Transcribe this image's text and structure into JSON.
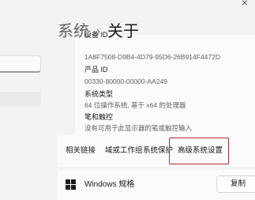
{
  "window": {
    "close_glyph": "×"
  },
  "header": {
    "parent": "系统",
    "separator": "›",
    "title": "关于"
  },
  "device_specs": {
    "device_id_label": "设备 ID",
    "device_id_value": "1A8F7508-D9B4-4D79-95D6-26B914F4472D",
    "product_id_label": "产品 ID",
    "product_id_value": "00330-80000-00000-AA249",
    "system_type_label": "系统类型",
    "system_type_value": "64 位操作系统, 基于 x64 的处理器",
    "pen_touch_label": "笔和触控",
    "pen_touch_value": "没有可用于此显示器的笔或触控输入"
  },
  "related_links": {
    "heading": "相关链接",
    "items": [
      "域或工作组",
      "系统保护",
      "高级系统设置"
    ],
    "highlight_color": "#a73235"
  },
  "windows_specs": {
    "label": "Windows 规格",
    "copy_label": "复制"
  }
}
